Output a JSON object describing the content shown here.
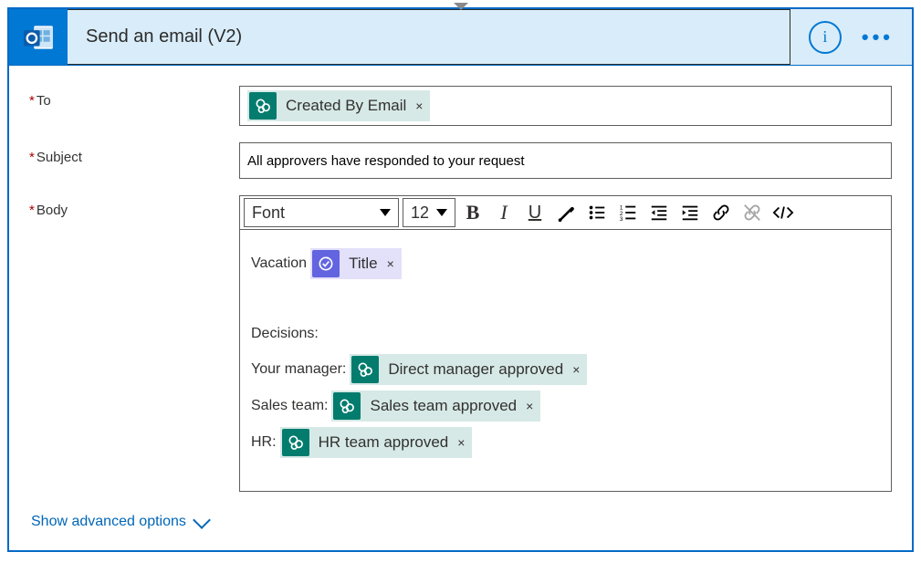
{
  "header": {
    "title": "Send an email (V2)",
    "info_symbol": "i",
    "ellipsis": "•••"
  },
  "fields": {
    "to": {
      "label": "To",
      "token_label": "Created By Email"
    },
    "subject": {
      "label": "Subject",
      "value": "All approvers have responded to your request"
    },
    "body": {
      "label": "Body"
    }
  },
  "toolbar": {
    "font_label": "Font",
    "size_label": "12"
  },
  "editor": {
    "line1_prefix": "Vacation",
    "title_token": "Title",
    "decisions_label": "Decisions:",
    "mgr_prefix": "Your manager:",
    "mgr_token": "Direct manager approved",
    "sales_prefix": "Sales team:",
    "sales_token": "Sales team approved",
    "hr_prefix": "HR:",
    "hr_token": "HR team approved"
  },
  "footer": {
    "advanced": "Show advanced options"
  },
  "glyphs": {
    "x": "×"
  }
}
